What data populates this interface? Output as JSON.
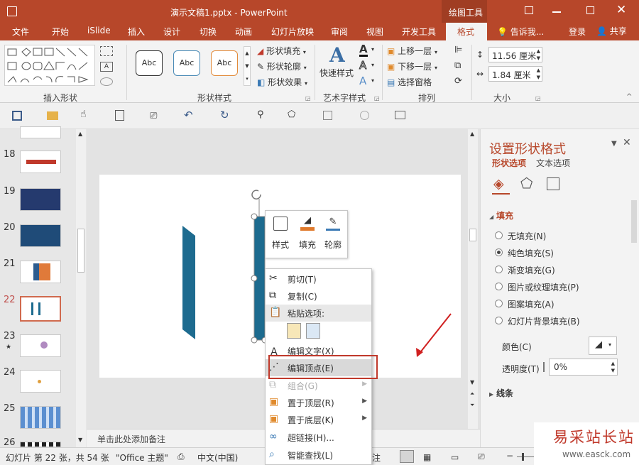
{
  "title_bar": {
    "title": "演示文稿1.pptx - PowerPoint",
    "tool_context": "绘图工具"
  },
  "tabs": [
    "文件",
    "开始",
    "iSlide",
    "插入",
    "设计",
    "切换",
    "动画",
    "幻灯片放映",
    "审阅",
    "视图",
    "开发工具",
    "格式"
  ],
  "active_tab": "格式",
  "tell_me": "告诉我...",
  "login": "登录",
  "share": "共享",
  "ribbon": {
    "insert_shapes": "插入形状",
    "shape_styles": "形状样式",
    "style_presets": [
      "Abc",
      "Abc",
      "Abc"
    ],
    "shape_fill": "形状填充",
    "shape_outline": "形状轮廓",
    "shape_effects": "形状效果",
    "quick_styles": "快速样式",
    "wordart_styles": "艺术字样式",
    "bring_forward": "上移一层",
    "send_backward": "下移一层",
    "selection_pane": "选择窗格",
    "arrange": "排列",
    "height": "11.56 厘米",
    "width": "1.84 厘米",
    "size": "大小"
  },
  "thumbnails": [
    {
      "num": "18"
    },
    {
      "num": "19"
    },
    {
      "num": "20"
    },
    {
      "num": "21"
    },
    {
      "num": "22"
    },
    {
      "num": "23",
      "star": "★"
    },
    {
      "num": "24"
    },
    {
      "num": "25"
    },
    {
      "num": "26"
    }
  ],
  "notes_placeholder": "单击此处添加备注",
  "mini_toolbar": [
    "样式",
    "填充",
    "轮廓"
  ],
  "context_menu": [
    {
      "label": "剪切(T)",
      "icon": "cut-icon",
      "enabled": true
    },
    {
      "label": "复制(C)",
      "icon": "copy-icon",
      "enabled": true
    },
    {
      "label": "粘贴选项:",
      "icon": "paste-icon",
      "enabled": true
    },
    {
      "label": "编辑文字(X)",
      "icon": "edit-text-icon",
      "enabled": true
    },
    {
      "label": "编辑顶点(E)",
      "icon": "edit-points-icon",
      "enabled": true
    },
    {
      "label": "组合(G)",
      "icon": "group-icon",
      "enabled": false
    },
    {
      "label": "置于顶层(R)",
      "icon": "bring-front-icon",
      "enabled": true
    },
    {
      "label": "置于底层(K)",
      "icon": "send-back-icon",
      "enabled": true
    },
    {
      "label": "超链接(H)...",
      "icon": "hyperlink-icon",
      "enabled": true
    },
    {
      "label": "智能查找(L)",
      "icon": "smart-lookup-icon",
      "enabled": true
    }
  ],
  "format_pane": {
    "title": "设置形状格式",
    "tab_shape": "形状选项",
    "tab_text": "文本选项",
    "fill_section": "填充",
    "fill_options": [
      "无填充(N)",
      "纯色填充(S)",
      "渐变填充(G)",
      "图片或纹理填充(P)",
      "图案填充(A)",
      "幻灯片背景填充(B)"
    ],
    "selected_fill": 1,
    "color_label": "颜色(C)",
    "transparency_label": "透明度(T)",
    "transparency_value": "0%",
    "line_section": "线条"
  },
  "status_bar": {
    "slide_info": "幻灯片 第 22 张，共 54 张",
    "theme": "\"Office 主题\"",
    "language": "中文(中国)",
    "notes_short": "注"
  },
  "watermark": {
    "text": "易采站长站",
    "url": "www.easck.com"
  },
  "colors": {
    "accent": "#b7472a",
    "shape_blue": "#1d6b8f",
    "highlight_box": "#c0392b"
  }
}
